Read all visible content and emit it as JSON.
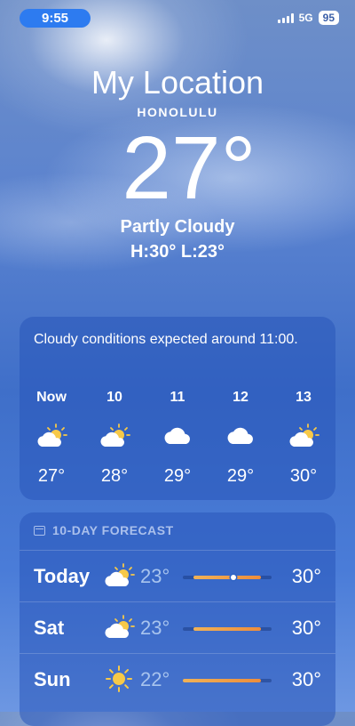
{
  "status": {
    "time": "9:55",
    "network": "5G",
    "battery": "95"
  },
  "header": {
    "location": "My Location",
    "city": "HONOLULU",
    "temperature": "27°",
    "condition": "Partly Cloudy",
    "high_low": "H:30°  L:23°"
  },
  "hourly": {
    "summary": "Cloudy conditions expected around 11:00.",
    "items": [
      {
        "label": "Now",
        "icon": "partly-cloudy-icon",
        "temp": "27°"
      },
      {
        "label": "10",
        "icon": "partly-cloudy-icon",
        "temp": "28°"
      },
      {
        "label": "11",
        "icon": "cloud-icon",
        "temp": "29°"
      },
      {
        "label": "12",
        "icon": "cloud-icon",
        "temp": "29°"
      },
      {
        "label": "13",
        "icon": "partly-cloudy-icon",
        "temp": "30°"
      }
    ]
  },
  "daily": {
    "title": "10-DAY FORECAST",
    "days": [
      {
        "day": "Today",
        "icon": "partly-cloudy-icon",
        "low": "23°",
        "high": "30°",
        "range_start": 0.12,
        "range_end": 0.88,
        "current": 0.57
      },
      {
        "day": "Sat",
        "icon": "partly-cloudy-icon",
        "low": "23°",
        "high": "30°",
        "range_start": 0.12,
        "range_end": 0.88
      },
      {
        "day": "Sun",
        "icon": "sun-icon",
        "low": "22°",
        "high": "30°",
        "range_start": 0.0,
        "range_end": 0.88
      }
    ]
  },
  "colors": {
    "accent": "#2d7bf0",
    "range_start": "#f0b257",
    "range_end": "#ee8d3b"
  }
}
